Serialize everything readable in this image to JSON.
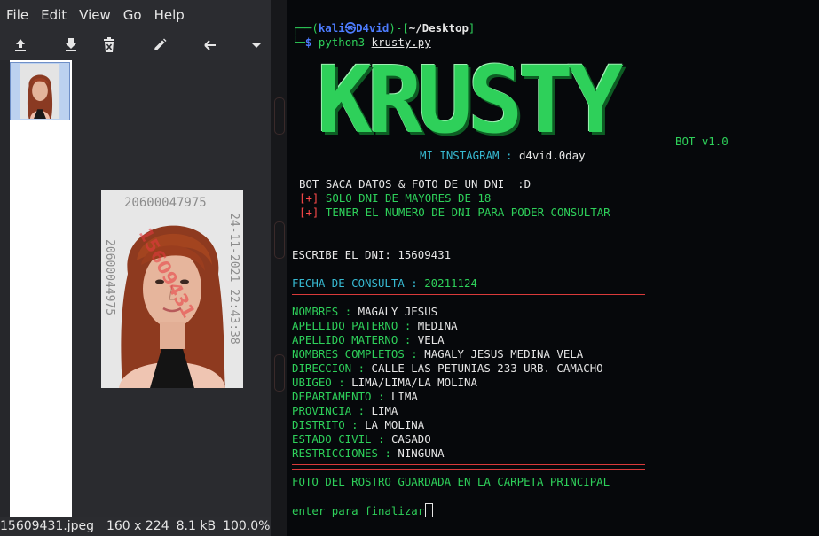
{
  "viewer": {
    "menu": [
      "File",
      "Edit",
      "View",
      "Go",
      "Help"
    ],
    "toolbar_icons": [
      "upload-icon",
      "save-icon",
      "delete-icon",
      "edit-icon",
      "back-arrow-icon",
      "dropdown-icon"
    ],
    "photo": {
      "stamp_top": "20600047975",
      "stamp_right": "24-11-2021 22:43:38",
      "stamp_left": "20600044975",
      "watermark": "15609431"
    },
    "status": {
      "filename": "15609431.jpeg",
      "dimensions": "160 x 224",
      "size": "8.1 kB",
      "zoom": "100.0%"
    }
  },
  "terminal": {
    "prompt": {
      "open": "┌──(",
      "user": "kali",
      "at": "㉿",
      "host": "D4vid",
      "mid": ")-[",
      "path": "~/Desktop",
      "close": "]",
      "line2": "└─",
      "dollar": "$",
      "command": "python3",
      "arg": "krusty.py"
    },
    "banner": {
      "title": "KRUSTY",
      "version": "BOT v1.0",
      "insta_label": "MI INSTAGRAM",
      "insta_sep": ":",
      "insta_handle": "d4vid.0day"
    },
    "intro": {
      "line1": "BOT SACA DATOS & FOTO DE UN DNI  :D",
      "plus": "[+]",
      "rule1": "SOLO DNI DE MAYORES DE 18",
      "rule2": "TENER EL NUMERO DE DNI PARA PODER CONSULTAR"
    },
    "query": {
      "prompt_label": "ESCRIBE EL DNI:",
      "dni": "15609431",
      "date_label": "FECHA DE CONSULTA :",
      "date": "20211124"
    },
    "fields": [
      {
        "label": "NOMBRES",
        "value": "MAGALY JESUS"
      },
      {
        "label": "APELLIDO PATERNO",
        "value": "MEDINA"
      },
      {
        "label": "APELLIDO MATERNO",
        "value": "VELA"
      },
      {
        "label": "NOMBRES COMPLETOS",
        "value": "MAGALY JESUS MEDINA VELA"
      },
      {
        "label": "DIRECCION",
        "value": "CALLE LAS PETUNIAS 233 URB. CAMACHO"
      },
      {
        "label": "UBIGEO",
        "value": "LIMA/LIMA/LA MOLINA"
      },
      {
        "label": "DEPARTAMENTO",
        "value": "LIMA"
      },
      {
        "label": "PROVINCIA",
        "value": "LIMA"
      },
      {
        "label": "DISTRITO",
        "value": "LA MOLINA"
      },
      {
        "label": "ESTADO CIVIL",
        "value": "CASADO"
      },
      {
        "label": "RESTRICCIONES",
        "value": "NINGUNA"
      }
    ],
    "field_sep": ":",
    "saved_msg": "FOTO DEL ROSTRO GUARDADA EN LA CARPETA PRINCIPAL",
    "final_prompt": "enter para finalizar"
  },
  "colors": {
    "prompt_blue": "#4d7cff",
    "banner_green": "#2ed05a",
    "label_cyan": "#37b9d1",
    "rule_red": "#d93a3a",
    "plus_red": "#ff4a4a"
  }
}
